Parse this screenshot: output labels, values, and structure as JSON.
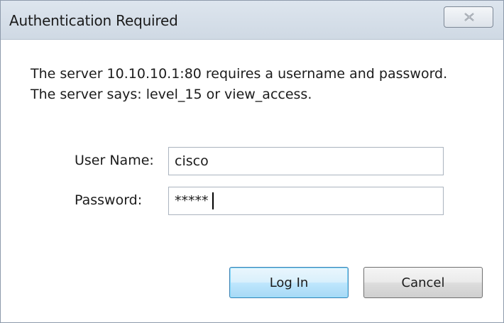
{
  "dialog": {
    "title": "Authentication Required",
    "close_icon": "close-icon",
    "message": "The server 10.10.10.1:80 requires a username and password. The server says: level_15 or view_access."
  },
  "form": {
    "username_label": "User Name:",
    "username_value": "cisco",
    "password_label": "Password:",
    "password_value": "*****"
  },
  "buttons": {
    "login_label": "Log In",
    "cancel_label": "Cancel"
  },
  "colors": {
    "titlebar": "#d6dee8",
    "default_button": "#bee6fd",
    "button": "#e5e5e5"
  }
}
